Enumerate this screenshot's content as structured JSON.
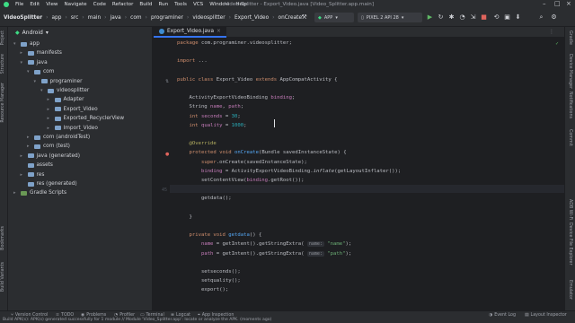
{
  "menu": {
    "items": [
      "File",
      "Edit",
      "View",
      "Navigate",
      "Code",
      "Refactor",
      "Build",
      "Run",
      "Tools",
      "VCS",
      "Window",
      "Help"
    ],
    "window_title": "Video Splitter - Export_Video.java [Video_Splitter.app.main]"
  },
  "breadcrumbs": [
    "VideoSplitter",
    "app",
    "src",
    "main",
    "java",
    "com",
    "programiner",
    "videosplitter",
    "Export_Video",
    "onCreate"
  ],
  "toolbar": {
    "config": "APP",
    "device": "PIXEL 2 API 28"
  },
  "project": {
    "view_label": "Android",
    "tree": [
      {
        "label": "app",
        "depth": 0,
        "arrow": "▾",
        "icon": "folder"
      },
      {
        "label": "manifests",
        "depth": 1,
        "arrow": "▸",
        "icon": "folder"
      },
      {
        "label": "java",
        "depth": 1,
        "arrow": "▾",
        "icon": "folder"
      },
      {
        "label": "com",
        "depth": 2,
        "arrow": "▾",
        "icon": "folder"
      },
      {
        "label": "programiner",
        "depth": 3,
        "arrow": "▾",
        "icon": "folder"
      },
      {
        "label": "videosplitter",
        "depth": 4,
        "arrow": "▾",
        "icon": "folder"
      },
      {
        "label": "Adapter",
        "depth": 5,
        "arrow": "▸",
        "icon": "folder"
      },
      {
        "label": "Export_Video",
        "depth": 5,
        "arrow": "▸",
        "icon": "folder"
      },
      {
        "label": "Exported_RecyclerView",
        "depth": 5,
        "arrow": "▸",
        "icon": "folder"
      },
      {
        "label": "Import_Video",
        "depth": 5,
        "arrow": "▸",
        "icon": "folder"
      },
      {
        "label": "com (androidTest)",
        "depth": 2,
        "arrow": "▸",
        "icon": "folder"
      },
      {
        "label": "com (test)",
        "depth": 2,
        "arrow": "▸",
        "icon": "folder"
      },
      {
        "label": "java (generated)",
        "depth": 1,
        "arrow": "▸",
        "icon": "folder"
      },
      {
        "label": "assets",
        "depth": 1,
        "arrow": "",
        "icon": "folder"
      },
      {
        "label": "res",
        "depth": 1,
        "arrow": "▸",
        "icon": "folder"
      },
      {
        "label": "res (generated)",
        "depth": 1,
        "arrow": "",
        "icon": "folder"
      },
      {
        "label": "Gradle Scripts",
        "depth": 0,
        "arrow": "▸",
        "icon": "gradle"
      }
    ]
  },
  "left_strip": [
    "Project",
    "Structure",
    "Resource Manager",
    "Bookmarks",
    "Build Variants"
  ],
  "right_strip": [
    "Gradle",
    "Device Manager",
    "Notifications",
    "Commit",
    "ADB Wi-Fi",
    "Device File Explorer",
    "Emulator"
  ],
  "editor": {
    "tab_label": "Export_Video.java",
    "lines": [
      {
        "n": "",
        "html": "<span class=\"kw\">package</span> com.programiner.videosplitter;"
      },
      {
        "n": "",
        "html": ""
      },
      {
        "n": "",
        "html": "<span class=\"kw\">import</span> ..."
      },
      {
        "n": "",
        "html": ""
      },
      {
        "n": "",
        "html": "<span class=\"kw\">public class</span> Export_Video <span class=\"kw\">extends</span> AppCompatActivity {"
      },
      {
        "n": "",
        "html": ""
      },
      {
        "n": "",
        "html": "    ActivityExportVideoBinding <span class=\"fld\">binding</span>;"
      },
      {
        "n": "",
        "html": "    String <span class=\"fld\">name</span>, <span class=\"fld\">path</span>;"
      },
      {
        "n": "",
        "html": "    <span class=\"kw\">int</span> <span class=\"fld\">seconds</span> = <span class=\"num\">30</span>;"
      },
      {
        "n": "",
        "html": "    <span class=\"kw\">int</span> <span class=\"fld\">quality</span> = <span class=\"num\">1000</span>;"
      },
      {
        "n": "",
        "html": ""
      },
      {
        "n": "",
        "html": "    <span class=\"ann\">@Override</span>"
      },
      {
        "n": "",
        "html": "    <span class=\"kw\">protected void</span> <span class=\"fn\">onCreate</span>(Bundle savedInstanceState) {"
      },
      {
        "n": "",
        "html": "        <span class=\"kw\">super</span>.onCreate(savedInstanceState);"
      },
      {
        "n": "",
        "html": "        <span class=\"fld\">binding</span> = ActivityExportVideoBinding.<i>inflate</i>(getLayoutInflater());"
      },
      {
        "n": "",
        "html": "        setContentView(<span class=\"fld\">binding</span>.getRoot());"
      },
      {
        "n": "45",
        "html": ""
      },
      {
        "n": "",
        "html": "        getdata();"
      },
      {
        "n": "",
        "html": ""
      },
      {
        "n": "",
        "html": "    }"
      },
      {
        "n": "",
        "html": ""
      },
      {
        "n": "",
        "html": "    <span class=\"kw\">private void</span> <span class=\"fn\">getdata</span>() {"
      },
      {
        "n": "",
        "html": "        <span class=\"fld\">name</span> = getIntent().getStringExtra( <span class=\"hint\">name:</span> <span class=\"str\">\"name\"</span>);"
      },
      {
        "n": "",
        "html": "        <span class=\"fld\">path</span> = getIntent().getStringExtra( <span class=\"hint\">name:</span> <span class=\"str\">\"path\"</span>);"
      },
      {
        "n": "",
        "html": ""
      },
      {
        "n": "",
        "html": "        setseconds();"
      },
      {
        "n": "",
        "html": "        setquality();"
      },
      {
        "n": "",
        "html": "        export();"
      }
    ]
  },
  "bottom_tabs": [
    "Version Control",
    "TODO",
    "Problems",
    "Profiler",
    "Terminal",
    "Logcat",
    "App Inspection"
  ],
  "bottom_right_tabs": [
    "Event Log",
    "Layout Inspector"
  ],
  "status_message": "Build APK(s): APK(s) generated successfully for 1 module // Module 'Video_Splitter.app': locate or analyze the APK. (moments ago)"
}
